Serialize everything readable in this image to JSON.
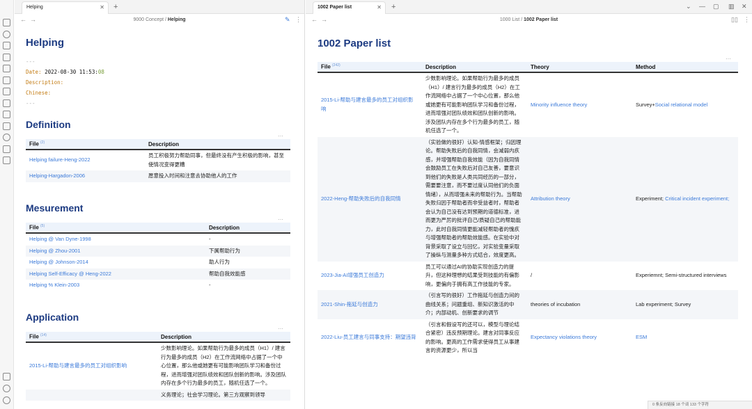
{
  "left": {
    "tab_title": "Helping",
    "breadcrumb_parent": "9000 Concept",
    "breadcrumb_sep": " / ",
    "breadcrumb_current": "Helping",
    "page_title": "Helping",
    "frontmatter": {
      "dashes_top": "---",
      "date_key": "Date:",
      "date_value": "2022-08-30 11:53:",
      "date_value_tail": "08",
      "description_key": "Description:",
      "chinese_key": "Chinese:",
      "dashes_bottom": "---"
    },
    "definition": {
      "title": "Definition",
      "col_file": "File",
      "count": "(2)",
      "col_desc": "Description",
      "rows": [
        {
          "file": "Helping failure-Heng-2022",
          "desc": "员工积极努力帮助同事，但最终没有产生积极的影响，甚至使情况变得更糟"
        },
        {
          "file": "Helping-Hargadon-2006",
          "desc": "愿意投入时间和注意去协助他人的工作"
        }
      ]
    },
    "measurement": {
      "title": "Mesurement",
      "col_file": "File",
      "count": "(5)",
      "col_desc": "Description",
      "rows": [
        {
          "file": "Helping @ Van Dyne-1998",
          "desc": "-"
        },
        {
          "file": "Helping @ Zhou-2001",
          "desc": "下属帮助行为"
        },
        {
          "file": "Helping @ Johnson-2014",
          "desc": "助人行为"
        },
        {
          "file": "Helping Self-Efficacy @ Heng-2022",
          "desc": "帮助自我效能感"
        },
        {
          "file": "Helping % Klein-2003",
          "desc": "-"
        }
      ]
    },
    "application": {
      "title": "Application",
      "col_file": "File",
      "count": "(14)",
      "col_desc": "Description",
      "rows": [
        {
          "file": "2015-Li-帮助与建言最多的员工对组织影响",
          "desc": "少数影响理论。如果帮助行为最多的成员（H1）/ 建言行为最多的成员（H2）在工作流网络中占据了一个中心位置，那么他或她更有可能影响团队学习和备份过程，进而增强对团队绩效和团队创新的影响。涉及团队内存在多个行为最多的员工，随机任选了一个。"
        },
        {
          "file": "",
          "desc": "义务理论；社会学习理论。第三方观察到领导"
        }
      ]
    }
  },
  "right": {
    "tab_title": "1002 Paper list",
    "breadcrumb_parent": "1000 List",
    "breadcrumb_sep": " / ",
    "breadcrumb_current": "1002 Paper list",
    "page_title": "1002 Paper list",
    "table": {
      "col_file": "File",
      "count": "(242)",
      "col_desc": "Description",
      "col_theory": "Theory",
      "col_method": "Method",
      "rows": [
        {
          "file": "2015-Li-帮助与建言最多的员工对组织影响",
          "desc": "少数影响理论。如果帮助行为最多的成员（H1）/ 建言行为最多的成员（H2）在工作流网络中占据了一个中心位置，那么他或她更有可能影响团队学习和备份过程，进而增强对团队绩效和团队创新的影响。涉及团队内存在多个行为最多的员工，随机任选了一个。",
          "theory": "Minority influence theory",
          "theory_link": true,
          "method_plain": "Survey+",
          "method_link": "Social relational model"
        },
        {
          "file": "2022-Heng-帮助失败后的自我同情",
          "desc": "（实验做的很好）认知-情感框架；归因理论。帮助失败后的自我同情，会减弱内疚感，并增强帮助自我效能（因为自我同情会鼓励员工在失败后对自己友善，要意识到他们的失败是人类共同经历的一部分，需要要注意，而不要过度认同他们的负面情绪），从而增强未来的帮助行为。当帮助失败归因于帮助者而非受益者时，帮助者会认为自己没有达到预期的道德标准，进而更为严厉的批评自己/质疑自己的帮助能力，此时自我同情更能减轻帮助者的愧疚与增强帮助者的帮助效能感。在实验中对背景采取了设立与回忆，对实验变量采取了操纵与测量多种方式结合，效度更高。",
          "theory": "Attribution theory",
          "theory_link": true,
          "method_plain": "Experiment;  ",
          "method_link": "Critical incident experiment;"
        },
        {
          "file": "2023-Jia-AI增强员工创造力",
          "desc": "员工可以通过AI的协助实现创造力的提升，但这种理想的结果受到技能的有偏影响，更偏向于拥有高工作技能的专家。",
          "theory": "/",
          "theory_link": false,
          "method_plain": "Experiemnt; Semi-structured interviews",
          "method_link": ""
        },
        {
          "file": "2021-Shin-拖延与创造力",
          "desc": "（引言写的很好）工作拖延与创造力间的曲线关系；问题重组、新知识激活的中介；内部动机、创新要求的调节",
          "theory": "theories of incubation",
          "theory_link": false,
          "method_plain": "Lab experiment;  Survey",
          "method_link": ""
        },
        {
          "file": "2022-Liu-员工建言与同事支持：期望违背",
          "desc": "（引言和假设写的还可以，模型与理论结合紧密）违反预期理论。建言对同事反应的影响。更高的工作需求使得员工从事建言的资源更少，所以当",
          "theory": "Expectancy violations theory",
          "theory_link": true,
          "method_plain": "",
          "method_link": "ESM"
        }
      ]
    },
    "status_bar": "0 条反向链接   18 个词   133 个字符"
  }
}
